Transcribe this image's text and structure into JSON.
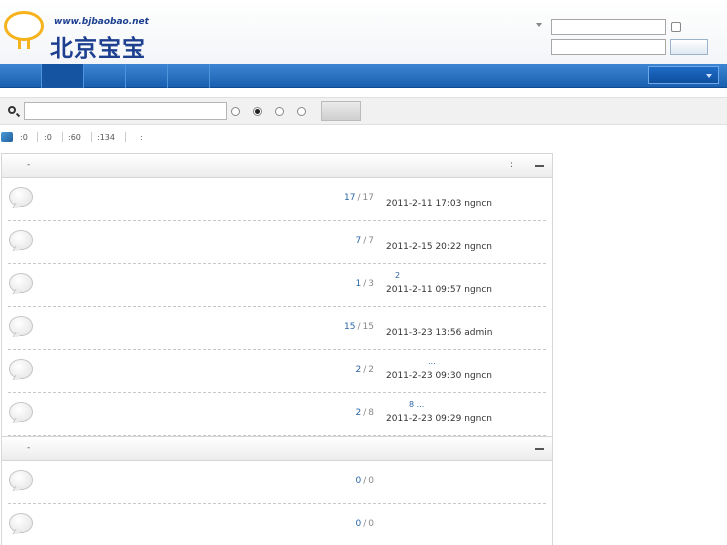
{
  "header": {
    "logo_url_text": "www.bjbaobao.net",
    "logo_cn_text": "北京宝宝"
  },
  "colors": {
    "nav_blue": "#1a5fb0",
    "link_blue": "#2a64a6",
    "logo_orange": "#f6b21b"
  },
  "stats": [
    {
      "label": ":0"
    },
    {
      "label": ":0"
    },
    {
      "label": ":60"
    },
    {
      "label": ":134"
    },
    {
      "label": ":"
    }
  ],
  "categories": [
    {
      "dash": "-",
      "colon": ":",
      "forums": [
        {
          "posts": "17",
          "sep": "/",
          "total": "17",
          "last_title": "",
          "last_post": "2011-2-11 17:03 ngncn"
        },
        {
          "posts": "7",
          "sep": "/",
          "total": "7",
          "last_title": "",
          "last_post": "2011-2-15 20:22 ngncn"
        },
        {
          "posts": "1",
          "sep": "/",
          "total": "3",
          "last_title": "2",
          "last_post": "2011-2-11 09:57 ngncn"
        },
        {
          "posts": "15",
          "sep": "/",
          "total": "15",
          "last_title": "",
          "last_post": "2011-3-23 13:56 admin"
        },
        {
          "posts": "2",
          "sep": "/",
          "total": "2",
          "last_title": "...",
          "last_post": "2011-2-23 09:30 ngncn"
        },
        {
          "posts": "2",
          "sep": "/",
          "total": "8",
          "last_title": "8    ...",
          "last_post": "2011-2-23 09:29 ngncn"
        }
      ]
    },
    {
      "dash": "-",
      "colon": "",
      "forums": [
        {
          "posts": "0",
          "sep": "/",
          "total": "0",
          "last_title": "",
          "last_post": ""
        },
        {
          "posts": "0",
          "sep": "/",
          "total": "0",
          "last_title": "",
          "last_post": ""
        }
      ]
    }
  ]
}
